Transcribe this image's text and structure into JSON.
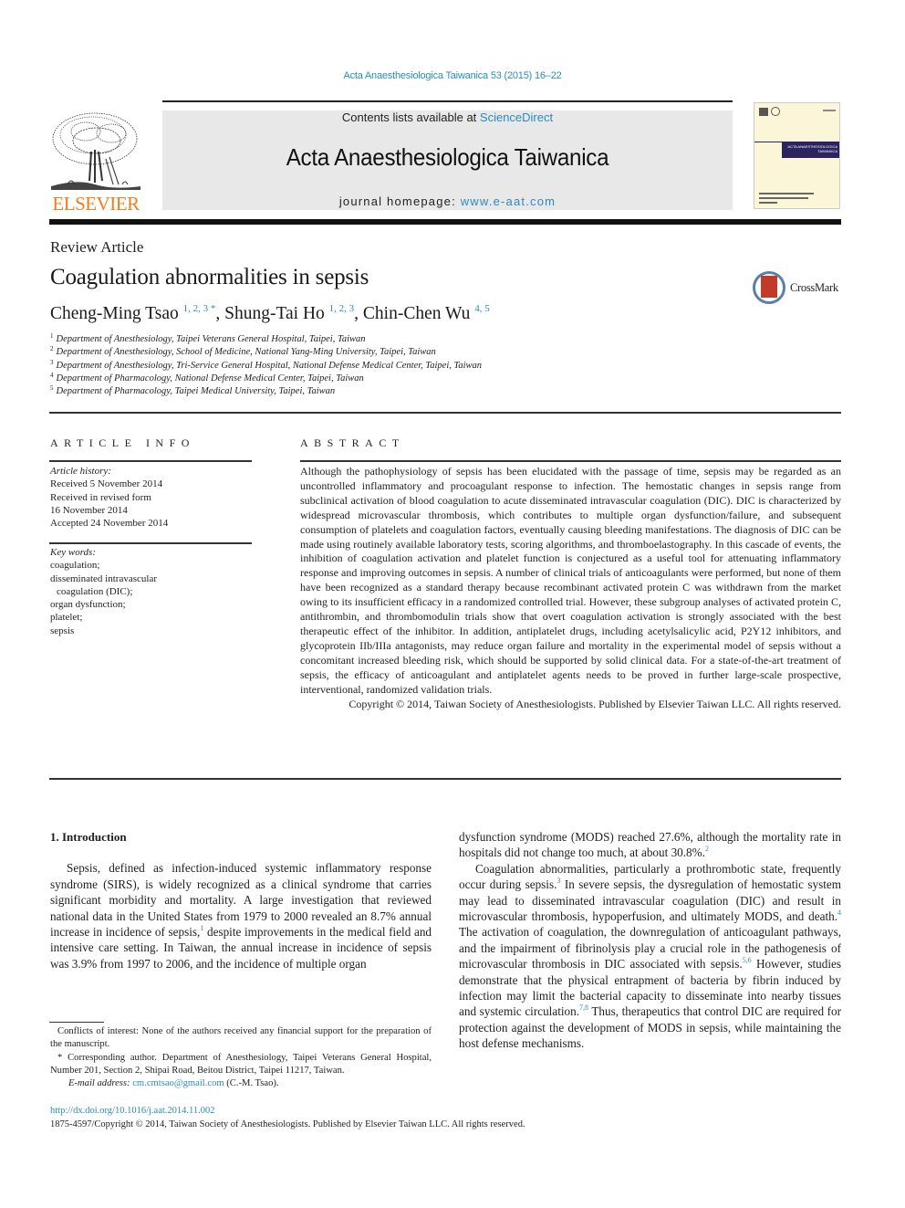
{
  "journal_ref": "Acta Anaesthesiologica Taiwanica 53 (2015) 16–22",
  "masthead": {
    "contents_prefix": "Contents lists available at ",
    "contents_link": "ScienceDirect",
    "journal_title": "Acta Anaesthesiologica Taiwanica",
    "homepage_prefix": "journal homepage: ",
    "homepage_link": "www.e-aat.com",
    "publisher_logo_text": "ELSEVIER",
    "cover_band_text": "ACTA ANAESTHESIOLOGICA TAIWANICA"
  },
  "colors": {
    "link": "#2a8bbf",
    "elsevier_orange": "#f07d1e",
    "masthead_bg": "#e8e8e8",
    "cover_band": "#2b2460",
    "crossmark_red": "#c23a2a"
  },
  "article": {
    "type": "Review Article",
    "title": "Coagulation abnormalities in sepsis",
    "crossmark_label": "CrossMark",
    "authors": [
      {
        "name": "Cheng-Ming Tsao",
        "sup": "1, 2, 3 *",
        "sep": ", "
      },
      {
        "name": "Shung-Tai Ho",
        "sup": "1, 2, 3",
        "sep": ", "
      },
      {
        "name": "Chin-Chen Wu",
        "sup": "4, 5",
        "sep": ""
      }
    ],
    "affiliations": [
      {
        "num": "1",
        "text": "Department of Anesthesiology, Taipei Veterans General Hospital, Taipei, Taiwan"
      },
      {
        "num": "2",
        "text": "Department of Anesthesiology, School of Medicine, National Yang-Ming University, Taipei, Taiwan"
      },
      {
        "num": "3",
        "text": "Department of Anesthesiology, Tri-Service General Hospital, National Defense Medical Center, Taipei, Taiwan"
      },
      {
        "num": "4",
        "text": "Department of Pharmacology, National Defense Medical Center, Taipei, Taiwan"
      },
      {
        "num": "5",
        "text": "Department of Pharmacology, Taipei Medical University, Taipei, Taiwan"
      }
    ]
  },
  "article_info": {
    "heading": "ARTICLE INFO",
    "history_label": "Article history:",
    "history": [
      "Received 5 November 2014",
      "Received in revised form",
      "16 November 2014",
      "Accepted 24 November 2014"
    ],
    "keywords_label": "Key words:",
    "keywords": [
      "coagulation;",
      "disseminated intravascular",
      "coagulation (DIC);",
      "organ dysfunction;",
      "platelet;",
      "sepsis"
    ]
  },
  "abstract": {
    "heading": "ABSTRACT",
    "body": "Although the pathophysiology of sepsis has been elucidated with the passage of time, sepsis may be regarded as an uncontrolled inflammatory and procoagulant response to infection. The hemostatic changes in sepsis range from subclinical activation of blood coagulation to acute disseminated intra­vascular coagulation (DIC). DIC is characterized by widespread microvascular thrombosis, which con­tributes to multiple organ dysfunction/failure, and subsequent consumption of platelets and coagulation factors, eventually causing bleeding manifestations. The diagnosis of DIC can be made using routinely available laboratory tests, scoring algorithms, and thromboelastography. In this cascade of events, the inhibition of coagulation activation and platelet function is conjectured as a useful tool for attenuating inflammatory response and improving outcomes in sepsis. A number of clinical trials of anticoagulants were performed, but none of them have been recognized as a standard therapy because recombinant activated protein C was withdrawn from the market owing to its insufficient efficacy in a randomized controlled trial. However, these subgroup analyses of activated protein C, antithrombin, and thrombo­modulin trials show that overt coagulation activation is strongly associated with the best therapeutic effect of the inhibitor. In addition, antiplatelet drugs, including acetylsalicylic acid, P2Y12 inhibitors, and glycoprotein IIb/IIIa antagonists, may reduce organ failure and mortality in the experimental model of sepsis without a concomitant increased bleeding risk, which should be supported by solid clinical data. For a state-of-the-art treatment of sepsis, the efficacy of anticoagulant and antiplatelet agents needs to be proved in further large-scale prospective, interventional, randomized validation trials.",
    "copyright": "Copyright © 2014, Taiwan Society of Anesthesiologists. Published by Elsevier Taiwan LLC. All rights reserved."
  },
  "introduction": {
    "heading": "1.  Introduction",
    "p1": [
      "Sepsis, defined as infection-induced systemic inflammatory response syndrome (SIRS), is widely recognized as a clinical syn­drome that carries significant morbidity and mortality. A large investigation that reviewed national data in the United States from 1979 to 2000 revealed an 8.7% annual increase in incidence of sepsis,",
      "1",
      " despite improvements in the medical field and intensive care setting. In Taiwan, the annual increase in incidence of sepsis was 3.9% from 1997 to 2006, and the incidence of multiple organ"
    ],
    "p1_cont": [
      "dysfunction syndrome (MODS) reached 27.6%, although the mor­tality rate in hospitals did not change too much, at about 30.8%.",
      "2"
    ],
    "p2": [
      "Coagulation abnormalities, particularly a prothrombotic state, frequently occur during sepsis.",
      "3",
      " In severe sepsis, the dysregulation of hemostatic system may lead to disseminated intravascular coagulation (DIC) and result in microvascular thrombosis, hypo­perfusion, and ultimately MODS, and death.",
      "4",
      " The activation of coagulation, the downregulation of anticoagulant pathways, and the impairment of fibrinolysis play a crucial role in the pathogen­esis of microvascular thrombosis in DIC associated with sepsis.",
      "5,6",
      " However, studies demonstrate that the physical entrapment of bacteria by fibrin induced by infection may limit the bacterial ca­pacity to disseminate into nearby tissues and systemic circula­tion.",
      "7,8",
      " Thus, therapeutics that control DIC are required for protection against the development of MODS in sepsis, while maintaining the host defense mechanisms."
    ]
  },
  "footnotes": {
    "conflicts": "Conflicts of interest: None of the authors received any financial support for the preparation of the manuscript.",
    "corresponding": "* Corresponding author. Department of Anesthesiology, Taipei Veterans General Hospital, Number 201, Section 2, Shipai Road, Beitou District, Taipei 11217, Taiwan.",
    "email_label": "E-mail address: ",
    "email": "cm.cmtsao@gmail.com",
    "email_suffix": " (C.-M. Tsao)."
  },
  "footer": {
    "doi": "http://dx.doi.org/10.1016/j.aat.2014.11.002",
    "issn_copyright": "1875-4597/Copyright © 2014, Taiwan Society of Anesthesiologists. Published by Elsevier Taiwan LLC. All rights reserved."
  }
}
